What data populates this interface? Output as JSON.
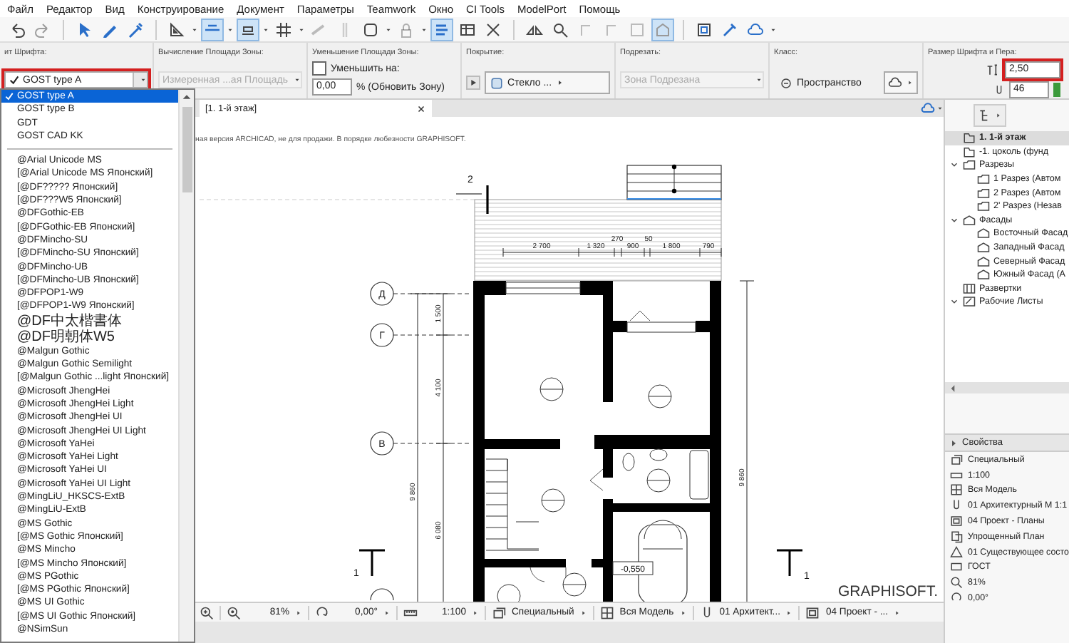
{
  "menu": [
    "Файл",
    "Редактор",
    "Вид",
    "Конструирование",
    "Документ",
    "Параметры",
    "Teamwork",
    "Окно",
    "CI Tools",
    "ModelPort",
    "Помощь"
  ],
  "toolbar": {
    "tools": [
      {
        "selected": false
      },
      {
        "selected": false
      },
      {
        "selected": false
      },
      {
        "selected": false
      },
      {
        "selected": false
      },
      {
        "selected": false
      },
      {
        "selected": true
      },
      {
        "selected": true
      },
      {
        "selected": false
      },
      {
        "selected": false
      },
      {
        "selected": false
      },
      {
        "selected": false
      },
      {
        "selected": false
      },
      {
        "selected": true
      },
      {
        "selected": false
      },
      {
        "selected": false
      },
      {
        "selected": false
      },
      {
        "selected": false
      },
      {
        "selected": false
      },
      {
        "selected": false
      },
      {
        "selected": false
      },
      {
        "selected": true
      },
      {
        "selected": false
      },
      {
        "selected": false
      },
      {
        "selected": false
      }
    ]
  },
  "info_box": {
    "sections": [
      {
        "kind": "font",
        "label": "ит Шрифта:",
        "value": "GOST type A",
        "highlighted": true
      },
      {
        "kind": "select",
        "label": "Вычисление Площади Зоны:",
        "value": "Измеренная ...ая Площадь",
        "disabled": true
      },
      {
        "kind": "reduce",
        "label": "Уменьшение Площади Зоны:",
        "checkbox_label": "Уменьшить на:",
        "checked": false,
        "value": "0,00",
        "suffix": "% (Обновить Зону)"
      },
      {
        "kind": "button",
        "label": "Покрытие:",
        "value": "Стекло ..."
      },
      {
        "kind": "select",
        "label": "Подрезать:",
        "value": "Зона Подрезана",
        "disabled": true
      },
      {
        "kind": "class",
        "label": "Класс:",
        "value": "Пространство"
      },
      {
        "kind": "size",
        "label": "Размер Шрифта и Пера:",
        "value": "2,50",
        "highlighted": true,
        "pen": "46"
      }
    ]
  },
  "tab": {
    "label": "[1. 1-й этаж]",
    "selected": true
  },
  "drawing": {
    "notice": "ная версия ARCHICAD, не для продажи. В порядке любезности GRAPHISOFT.",
    "logo": "GRAPHISOFT.",
    "horizontal_dimensions": [
      "2 700",
      "1 320",
      "270",
      "900",
      "50",
      "1 800",
      "790"
    ],
    "vertical_dimensions": [
      "1 500",
      "4 100",
      "9 860",
      "6 080",
      "9 860"
    ],
    "grid_axes": [
      "Д",
      "Г",
      "В"
    ],
    "section_marks": [
      "2",
      "1",
      "1"
    ],
    "level_tag": "-0,550"
  },
  "status_bar": {
    "zoom": "81%",
    "angle": "0,00°",
    "scale": "1:100",
    "items": [
      "Специальный",
      "Вся Модель",
      "01 Архитект...",
      "04 Проект - ..."
    ]
  },
  "navigator": {
    "items": [
      {
        "kind": "story",
        "label": "1. 1-й этаж",
        "selected": true
      },
      {
        "kind": "story",
        "label": "-1. цоколь (фунд",
        "selected": false
      },
      {
        "kind": "section",
        "label": "Разрезы",
        "selected": false,
        "expanded": true,
        "children": [
          {
            "kind": "section",
            "label": "1 Разрез (Автом",
            "selected": false
          },
          {
            "kind": "section",
            "label": "2 Разрез (Автом",
            "selected": false
          },
          {
            "kind": "section",
            "label": "2' Разрез (Незав",
            "selected": false
          }
        ]
      },
      {
        "kind": "elevation",
        "label": "Фасады",
        "selected": false,
        "expanded": true,
        "children": [
          {
            "kind": "elevation",
            "label": "Восточный Фасад",
            "selected": false
          },
          {
            "kind": "elevation",
            "label": "Западный Фасад",
            "selected": false
          },
          {
            "kind": "elevation",
            "label": "Северный Фасад",
            "selected": false
          },
          {
            "kind": "elevation",
            "label": "Южный Фасад (А",
            "selected": false
          }
        ]
      },
      {
        "kind": "interior",
        "label": "Развертки",
        "selected": false
      },
      {
        "kind": "worksheet",
        "label": "Рабочие Листы",
        "selected": false,
        "expanded": true
      }
    ]
  },
  "properties": {
    "title": "Свойства",
    "expanded": false,
    "rows": [
      "Специальный",
      "1:100",
      "Вся Модель",
      "01 Архитектурный М 1:1",
      "04 Проект - Планы",
      "Упрощенный План",
      "01 Существующее состо",
      "ГОСТ",
      "81%",
      "0,00°"
    ]
  },
  "font_menu": {
    "items": [
      {
        "kind": "font",
        "label": "GOST type A",
        "selected": true
      },
      {
        "kind": "font",
        "label": "GOST type B",
        "selected": false
      },
      {
        "kind": "font",
        "label": "GDT",
        "selected": false
      },
      {
        "kind": "font",
        "label": "GOST CAD KK",
        "selected": false
      },
      {
        "kind": "separator"
      },
      {
        "kind": "font",
        "label": "@Arial Unicode MS",
        "selected": false
      },
      {
        "kind": "font",
        "label": "[@Arial Unicode MS Японский]",
        "selected": false
      },
      {
        "kind": "font",
        "label": "[@DF????? Японский]",
        "selected": false
      },
      {
        "kind": "font",
        "label": "[@DF???W5 Японский]",
        "selected": false
      },
      {
        "kind": "font",
        "label": "@DFGothic-EB",
        "selected": false
      },
      {
        "kind": "font",
        "label": "[@DFGothic-EB Японский]",
        "selected": false
      },
      {
        "kind": "font",
        "label": "@DFMincho-SU",
        "selected": false
      },
      {
        "kind": "font",
        "label": "[@DFMincho-SU Японский]",
        "selected": false
      },
      {
        "kind": "font",
        "label": "@DFMincho-UB",
        "selected": false
      },
      {
        "kind": "font",
        "label": "[@DFMincho-UB Японский]",
        "selected": false
      },
      {
        "kind": "font",
        "label": "@DFPOP1-W9",
        "selected": false
      },
      {
        "kind": "font",
        "label": "[@DFPOP1-W9 Японский]",
        "selected": false
      },
      {
        "kind": "font",
        "label": "@DF中太楷書体",
        "selected": false
      },
      {
        "kind": "font",
        "label": "@DF明朝体W5",
        "selected": false
      },
      {
        "kind": "font",
        "label": "@Malgun Gothic",
        "selected": false
      },
      {
        "kind": "font",
        "label": "@Malgun Gothic Semilight",
        "selected": false
      },
      {
        "kind": "font",
        "label": "[@Malgun Gothic ...light Японский]",
        "selected": false
      },
      {
        "kind": "font",
        "label": "@Microsoft JhengHei",
        "selected": false
      },
      {
        "kind": "font",
        "label": "@Microsoft JhengHei Light",
        "selected": false
      },
      {
        "kind": "font",
        "label": "@Microsoft JhengHei UI",
        "selected": false
      },
      {
        "kind": "font",
        "label": "@Microsoft JhengHei UI Light",
        "selected": false
      },
      {
        "kind": "font",
        "label": "@Microsoft YaHei",
        "selected": false
      },
      {
        "kind": "font",
        "label": "@Microsoft YaHei Light",
        "selected": false
      },
      {
        "kind": "font",
        "label": "@Microsoft YaHei UI",
        "selected": false
      },
      {
        "kind": "font",
        "label": "@Microsoft YaHei UI Light",
        "selected": false
      },
      {
        "kind": "font",
        "label": "@MingLiU_HKSCS-ExtB",
        "selected": false
      },
      {
        "kind": "font",
        "label": "@MingLiU-ExtB",
        "selected": false
      },
      {
        "kind": "font",
        "label": "@MS Gothic",
        "selected": false
      },
      {
        "kind": "font",
        "label": "[@MS Gothic Японский]",
        "selected": false
      },
      {
        "kind": "font",
        "label": "@MS Mincho",
        "selected": false
      },
      {
        "kind": "font",
        "label": "[@MS Mincho Японский]",
        "selected": false
      },
      {
        "kind": "font",
        "label": "@MS PGothic",
        "selected": false
      },
      {
        "kind": "font",
        "label": "[@MS PGothic Японский]",
        "selected": false
      },
      {
        "kind": "font",
        "label": "@MS UI Gothic",
        "selected": false
      },
      {
        "kind": "font",
        "label": "[@MS UI Gothic Японский]",
        "selected": false
      },
      {
        "kind": "font",
        "label": "@NSimSun",
        "selected": false
      }
    ]
  }
}
